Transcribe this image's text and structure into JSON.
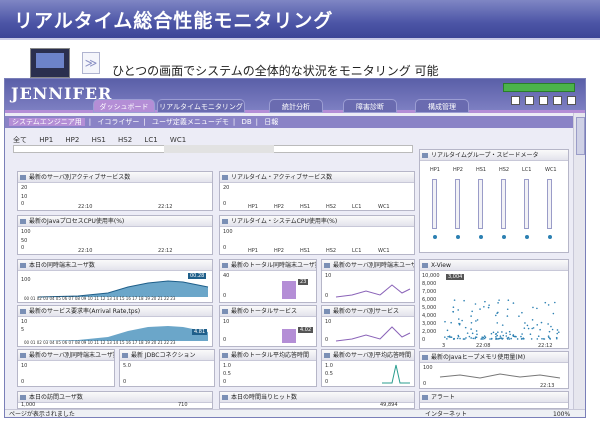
{
  "slide": {
    "title": "リアルタイム総合性能モニタリング",
    "description": "ひとつの画面でシステムの全体的な状況をモニタリング 可能"
  },
  "app": {
    "logo": "JENNIFER",
    "tabs": [
      "ダッシュボード",
      "リアルタイムモニタリング",
      "統計分析",
      "障害診断",
      "構成管理"
    ],
    "subnav": [
      "システムエンジニア用",
      "イコライザー",
      "ユーザ定義メニューデモ",
      "DB",
      "日報"
    ],
    "hosts": [
      "全て",
      "HP1",
      "HP2",
      "HS1",
      "HS2",
      "LC1",
      "WC1"
    ]
  },
  "panels": {
    "arrival": {
      "title": "最新のサーバ別アクティブサービス数",
      "y": [
        "20",
        "10",
        "0"
      ],
      "x": [
        "22:10",
        "22:12"
      ]
    },
    "active_service": {
      "title": "リアルタイム・アクティブサービス数",
      "y": [
        "20",
        "10",
        "0"
      ],
      "x": [
        "HP1",
        "HP2",
        "HS1",
        "HS2",
        "LC1",
        "WC1"
      ]
    },
    "java_cpu": {
      "title": "最新のJavaプロセスCPU使用率(%)",
      "y": [
        "100",
        "50",
        "0"
      ],
      "x": [
        "22:10",
        "22:12"
      ]
    },
    "sys_cpu": {
      "title": "リアルタイム・システムCPU使用率(%)",
      "y": [
        "100",
        "50",
        "0"
      ],
      "x": [
        "HP1",
        "HP2",
        "HS1",
        "HS2",
        "LC1",
        "WC1"
      ]
    },
    "group_speed": {
      "title": "リアルタイムグループ・スピードメータ",
      "x": [
        "HP1",
        "HP2",
        "HS1",
        "HS2",
        "LC1",
        "WC1"
      ]
    },
    "today_users": {
      "title": "本日の同時端末ユーザ数",
      "y": [
        "100",
        "0"
      ],
      "x": "00 01 02 03 04 05 06 07 08 09 10 11 12 13 14 15 16 17 18 19 20 21 22 23",
      "badge": "00.28"
    },
    "total_users": {
      "title": "最新のトータル同時端末ユーザ数",
      "y": [
        "40",
        "20",
        "0"
      ],
      "badge": "23"
    },
    "server_users": {
      "title": "最新のサーバ別同時端末ユーザ数",
      "y": [
        "10",
        "5",
        "0"
      ]
    },
    "xview": {
      "title": "X-View",
      "y": [
        "10,000",
        "9,000",
        "8,000",
        "7,000",
        "6,000",
        "5,000",
        "4,000",
        "3,000",
        "2,000",
        "1,000",
        "0"
      ],
      "x": [
        "3",
        "22:08",
        "22:12"
      ],
      "badge": "3,004"
    },
    "arrival_rate": {
      "title": "最新のサービス要求率(Arrival Rate,tps)",
      "y": [
        "10",
        "5",
        "0"
      ],
      "x": "00 01 02 03 04 05 06 07 08 09 10 11 12 13 14 15 16 17 18 19 20 21 22 23",
      "badge": "4.81"
    },
    "total_service": {
      "title": "最新のトータルサービス",
      "y": [
        "10",
        "5",
        "0"
      ],
      "badge": "4.02"
    },
    "server_service": {
      "title": "最新のサーバ別サービス",
      "y": [
        "10",
        "5",
        "0"
      ]
    },
    "server_users2": {
      "title": "最新のサーバ別同時端末ユーザ数",
      "y": [
        "10",
        "5",
        "0"
      ]
    },
    "jdbc": {
      "title": "最新 JDBCコネクション",
      "y": [
        "5.0",
        "0"
      ]
    },
    "total_resp": {
      "title": "最新のトータル平均応答時間",
      "y": [
        "1.0",
        "0.5",
        "0"
      ]
    },
    "server_resp": {
      "title": "最新のサーバ別平均応答時間",
      "y": [
        "1.0",
        "0.5",
        "0"
      ]
    },
    "heap": {
      "title": "最新のJavaヒープメモリ使用量(M)",
      "y": [
        "100",
        "0"
      ],
      "x": [
        "22:13"
      ]
    },
    "today_visits": {
      "title": "本日の訪問ユーザ数",
      "y": [
        "1,000"
      ],
      "badge": "710"
    },
    "hourly": {
      "title": "本日の時間当りヒット数",
      "badge": "49,894"
    },
    "alerts": {
      "title": "アラート"
    }
  },
  "status": {
    "left": "ページが表示されました",
    "zone": "インターネット",
    "zoom": "100%"
  },
  "colors": {
    "accent": "#4c55a6",
    "chart": "#2c80b2",
    "purple": "#b48ed6"
  }
}
